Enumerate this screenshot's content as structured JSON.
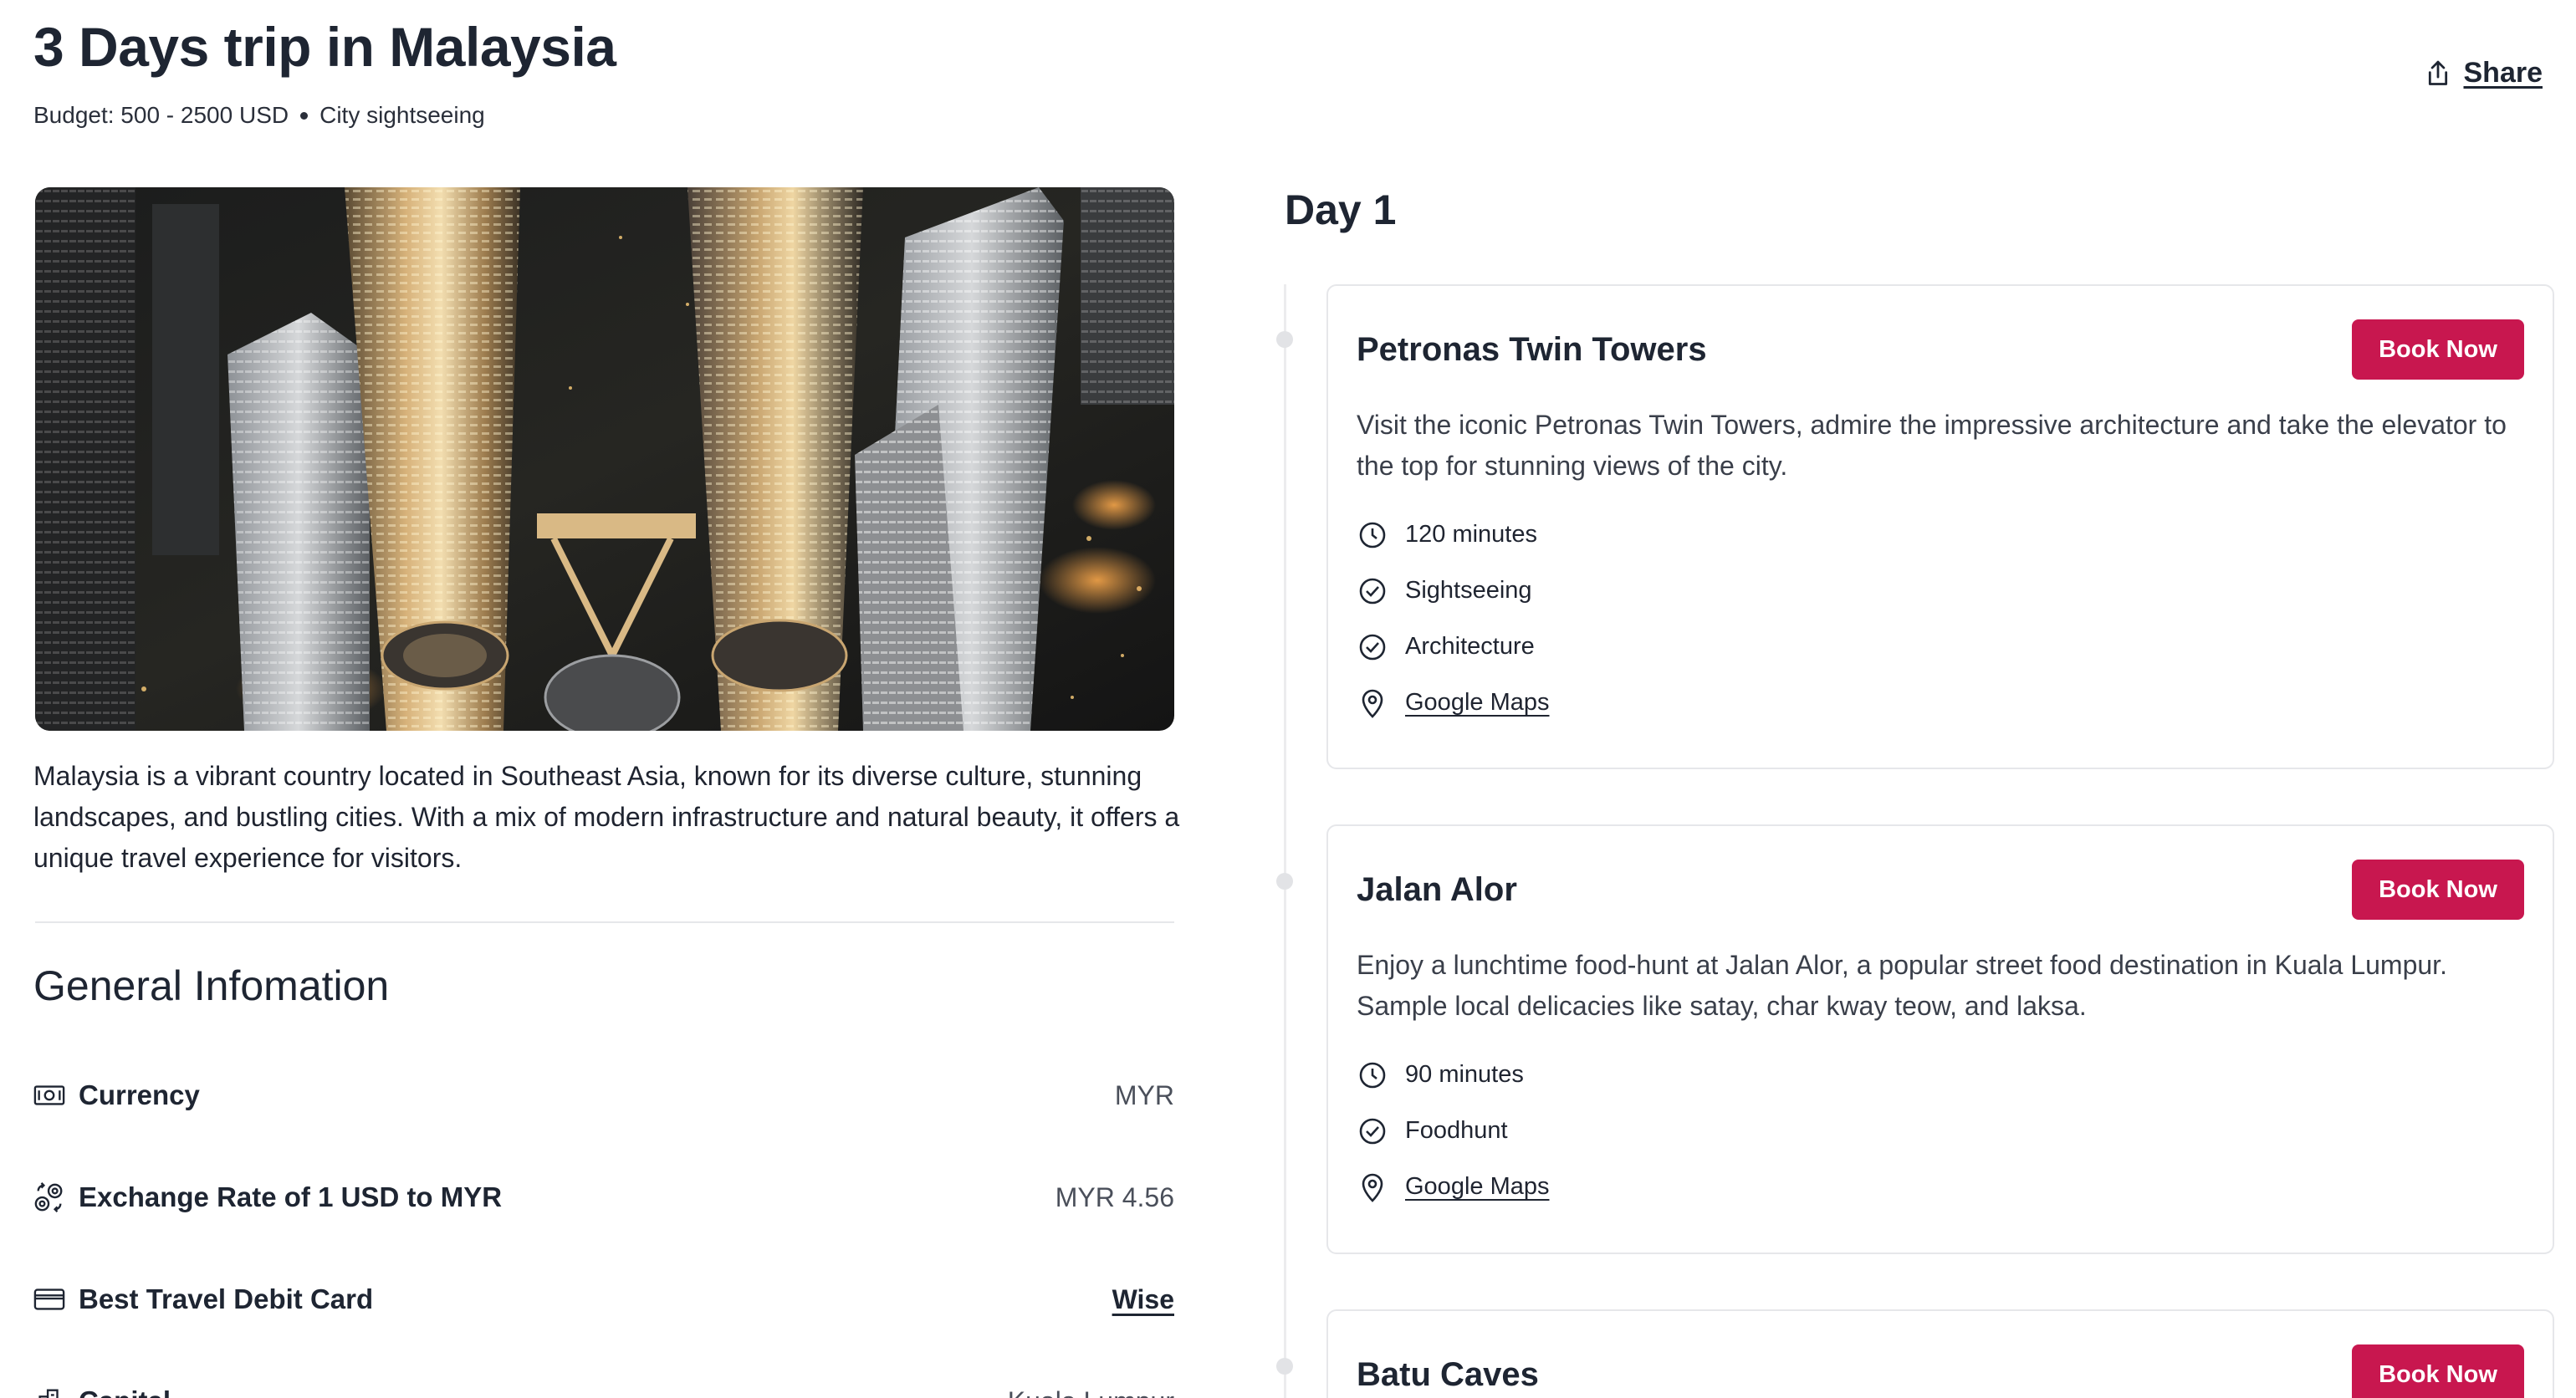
{
  "header": {
    "title": "3 Days trip in Malaysia",
    "budget": "Budget: 500 - 2500 USD",
    "style": "City sightseeing",
    "share_label": "Share"
  },
  "hero": {
    "image_alt": "Aerial view of Petronas Twin Towers at night"
  },
  "description": "Malaysia is a vibrant country located in Southeast Asia, known for its diverse culture, stunning landscapes, and bustling cities. With a mix of modern infrastructure and natural beauty, it offers a unique travel experience for visitors.",
  "general": {
    "title": "General Infomation",
    "rows": [
      {
        "icon": "banknote-icon",
        "label": "Currency",
        "value": "MYR"
      },
      {
        "icon": "exchange-coins-icon",
        "label": "Exchange Rate of 1 USD to MYR",
        "value": "MYR 4.56"
      },
      {
        "icon": "credit-card-icon",
        "label": "Best Travel Debit Card",
        "value": "Wise"
      },
      {
        "icon": "building-icon",
        "label": "Capital",
        "value": "Kuala Lumpur"
      }
    ]
  },
  "itinerary": {
    "day_title": "Day 1",
    "book_label": "Book Now",
    "activities": [
      {
        "title": "Petronas Twin Towers",
        "description": "Visit the iconic Petronas Twin Towers, admire the impressive architecture and take the elevator to the top for stunning views of the city.",
        "duration": "120 minutes",
        "tags": [
          "Sightseeing",
          "Architecture"
        ],
        "maps_label": "Google Maps"
      },
      {
        "title": "Jalan Alor",
        "description": "Enjoy a lunchtime food-hunt at Jalan Alor, a popular street food destination in Kuala Lumpur. Sample local delicacies like satay, char kway teow, and laksa.",
        "duration": "90 minutes",
        "tags": [
          "Foodhunt"
        ],
        "maps_label": "Google Maps"
      },
      {
        "title": "Batu Caves"
      }
    ]
  },
  "colors": {
    "accent": "#c8174f",
    "text": "#1e2532",
    "border": "#e6e7ea"
  }
}
